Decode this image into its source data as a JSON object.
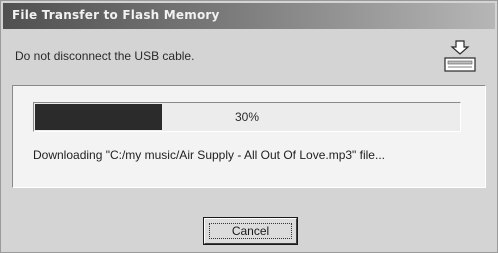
{
  "window": {
    "title": "File Transfer to Flash Memory"
  },
  "dialog": {
    "instruction": "Do not disconnect the USB cable.",
    "device_icon": "usb-device-icon",
    "progress": {
      "percent": 30,
      "label": "30%"
    },
    "status": "Downloading \"C:/my music/Air Supply - All Out Of Love.mp3\" file...",
    "cancel_label": "Cancel"
  },
  "colors": {
    "titlebar_start": "#505050",
    "titlebar_end": "#b6b6b6",
    "progress_fill": "#2b2b2b",
    "face": "#d4d4d4"
  }
}
